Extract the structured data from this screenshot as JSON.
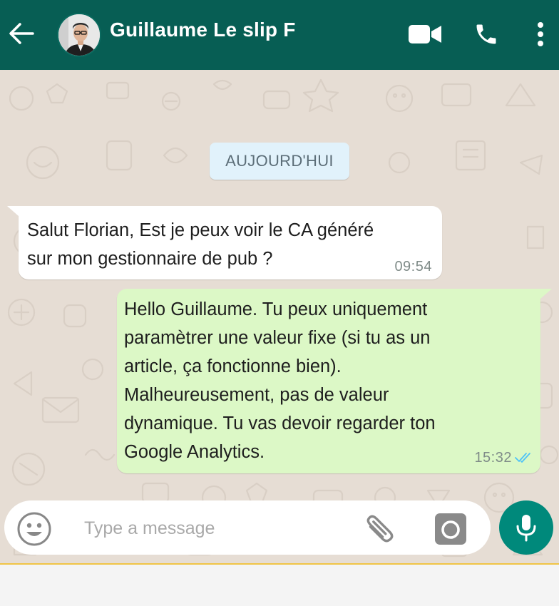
{
  "header": {
    "contact_name": "Guillaume Le slip F",
    "icons": {
      "back": "arrow-left-icon",
      "video": "video-camera-icon",
      "call": "phone-icon",
      "menu": "kebab-menu-icon"
    }
  },
  "chat": {
    "date_label": "AUJOURD'HUI",
    "messages": [
      {
        "direction": "incoming",
        "lines": [
          "Salut Florian, Est je peux voir le CA généré",
          "sur mon gestionnaire de pub ?"
        ],
        "time": "09:54"
      },
      {
        "direction": "outgoing",
        "lines": [
          "Hello Guillaume. Tu peux uniquement",
          "paramètrer une valeur fixe (si tu as un",
          "article, ça fonctionne bien).",
          "Malheureusement, pas de valeur",
          "dynamique. Tu vas devoir regarder ton",
          "Google Analytics."
        ],
        "time": "15:32",
        "status": "read"
      }
    ]
  },
  "composer": {
    "placeholder": "Type a message",
    "value": ""
  },
  "colors": {
    "header": "#075e54",
    "outgoing_bubble": "#dcf8c6",
    "incoming_bubble": "#ffffff",
    "date_chip": "#e1f2fb",
    "mic_button": "#00897b",
    "read_ticks": "#4fc3f7"
  }
}
